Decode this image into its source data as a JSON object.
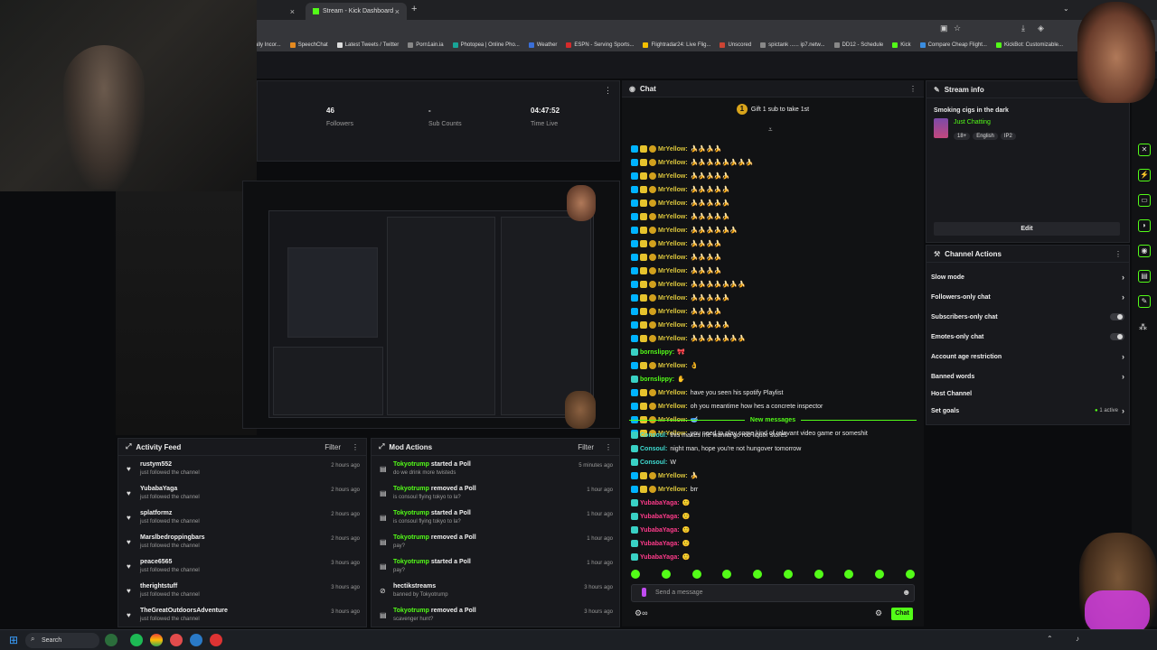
{
  "browser": {
    "tabs": [
      {
        "label": "Stream - Kick Dashboard",
        "active": true
      }
    ],
    "bookmarks": [
      "ally Incor...",
      "SpeechChat",
      "Latest Tweets / Twitter",
      "Porn1ain.ia",
      "Photopea | Online Pho...",
      "Weather",
      "ESPN - Serving Sports...",
      "Flightradar24: Live Flig...",
      "Unscored",
      "spictank ...... ip7.netw...",
      "DD12 - Schedule",
      "Kick",
      "Compare Cheap Flight...",
      "KickBot: Customizable..."
    ]
  },
  "stats": [
    {
      "value": "46",
      "label": "Followers"
    },
    {
      "value": "-",
      "label": "Sub Counts"
    },
    {
      "value": "04:47:52",
      "label": "Time Live"
    }
  ],
  "activity_feed": {
    "title": "Activity Feed",
    "filter_label": "Filter",
    "items": [
      {
        "name": "rustym552",
        "action": "just followed the channel",
        "time": "2 hours ago"
      },
      {
        "name": "YubabaYaga",
        "action": "just followed the channel",
        "time": "2 hours ago"
      },
      {
        "name": "splatformz",
        "action": "just followed the channel",
        "time": "2 hours ago"
      },
      {
        "name": "Marslbedroppingbars",
        "action": "just followed the channel",
        "time": "2 hours ago"
      },
      {
        "name": "peace6565",
        "action": "just followed the channel",
        "time": "3 hours ago"
      },
      {
        "name": "therightstuff",
        "action": "just followed the channel",
        "time": "3 hours ago"
      },
      {
        "name": "TheGreatOutdoorsAdventure",
        "action": "just followed the channel",
        "time": "3 hours ago"
      }
    ]
  },
  "mod_actions": {
    "title": "Mod Actions",
    "filter_label": "Filter",
    "items": [
      {
        "actor": "Tokyotrump",
        "verb": "started a Poll",
        "detail": "do we drink more twisteds",
        "time": "5 minutes ago"
      },
      {
        "actor": "Tokyotrump",
        "verb": "removed a Poll",
        "detail": "is consoul flying tokyo to la?",
        "time": "1 hour ago"
      },
      {
        "actor": "Tokyotrump",
        "verb": "started a Poll",
        "detail": "is consoul flying tokyo to la?",
        "time": "1 hour ago"
      },
      {
        "actor": "Tokyotrump",
        "verb": "removed a Poll",
        "detail": "pay?",
        "time": "1 hour ago"
      },
      {
        "actor": "Tokyotrump",
        "verb": "started a Poll",
        "detail": "pay?",
        "time": "1 hour ago"
      },
      {
        "actor": "hectikstreams",
        "verb": "",
        "detail": "banned by Tokyotrump",
        "time": "3 hours ago"
      },
      {
        "actor": "Tokyotrump",
        "verb": "removed a Poll",
        "detail": "scavenger hunt?",
        "time": "3 hours ago"
      }
    ]
  },
  "chat": {
    "title": "Chat",
    "gift_banner": "Gift 1 sub to take 1st",
    "messages": [
      {
        "user": "MrYellow:",
        "text": "🍌🍌🍌🍌",
        "color": "yellow"
      },
      {
        "user": "MrYellow:",
        "text": "🍌🍌🍌🍌🍌🍌🍌🍌",
        "color": "yellow"
      },
      {
        "user": "MrYellow:",
        "text": "🍌🍌🍌🍌🍌",
        "color": "yellow"
      },
      {
        "user": "MrYellow:",
        "text": "🍌🍌🍌🍌🍌",
        "color": "yellow"
      },
      {
        "user": "MrYellow:",
        "text": "🍌🍌🍌🍌🍌",
        "color": "yellow"
      },
      {
        "user": "MrYellow:",
        "text": "🍌🍌🍌🍌🍌",
        "color": "yellow"
      },
      {
        "user": "MrYellow:",
        "text": "🍌🍌🍌🍌🍌🍌",
        "color": "yellow"
      },
      {
        "user": "MrYellow:",
        "text": "🍌🍌🍌🍌",
        "color": "yellow"
      },
      {
        "user": "MrYellow:",
        "text": "🍌🍌🍌🍌",
        "color": "yellow"
      },
      {
        "user": "MrYellow:",
        "text": "🍌🍌🍌🍌",
        "color": "yellow"
      },
      {
        "user": "MrYellow:",
        "text": "🍌🍌🍌🍌🍌🍌🍌",
        "color": "yellow"
      },
      {
        "user": "MrYellow:",
        "text": "🍌🍌🍌🍌🍌",
        "color": "yellow"
      },
      {
        "user": "MrYellow:",
        "text": "🍌🍌🍌🍌",
        "color": "yellow"
      },
      {
        "user": "MrYellow:",
        "text": "🍌🍌🍌🍌🍌",
        "color": "yellow"
      },
      {
        "user": "MrYellow:",
        "text": "🍌🍌🍌🍌🍌🍌🍌",
        "color": "yellow"
      },
      {
        "user": "bornslippy:",
        "text": "🎀",
        "color": "green"
      },
      {
        "user": "MrYellow:",
        "text": "👌",
        "color": "yellow"
      },
      {
        "user": "bornslippy:",
        "text": "✋",
        "color": "green"
      },
      {
        "user": "MrYellow:",
        "text": "have you seen his spotify Playlist",
        "color": "yellow"
      },
      {
        "user": "MrYellow:",
        "text": "oh you meantime how hes a concrete inspector",
        "color": "yellow"
      },
      {
        "user": "MrYellow:",
        "text": "🥣",
        "color": "yellow"
      },
      {
        "user": "MrYellow:",
        "text": "you need to play some kind of relevant video game or someshit",
        "color": "yellow"
      }
    ],
    "new_messages_label": "New messages",
    "new_messages": [
      {
        "user": "Consoul:",
        "text": "this makes me wanna go rob liquor stores",
        "color": "teal"
      },
      {
        "user": "Consoul:",
        "text": "night man, hope you're not hungover tomorrow",
        "color": "teal"
      },
      {
        "user": "Consoul:",
        "text": "W",
        "color": "teal"
      },
      {
        "user": "MrYellow:",
        "text": "🍌",
        "color": "yellow"
      },
      {
        "user": "MrYellow:",
        "text": "brr",
        "color": "yellow"
      },
      {
        "user": "YubabaYaga:",
        "text": "🙂",
        "color": "pink"
      },
      {
        "user": "YubabaYaga:",
        "text": "🙂",
        "color": "pink"
      },
      {
        "user": "YubabaYaga:",
        "text": "🙂",
        "color": "pink"
      },
      {
        "user": "YubabaYaga:",
        "text": "🙂",
        "color": "pink"
      },
      {
        "user": "YubabaYaga:",
        "text": "🙂",
        "color": "pink"
      }
    ],
    "input_placeholder": "Send a message",
    "send_label": "Chat"
  },
  "stream_info": {
    "title_label": "Stream info",
    "stream_title": "Smoking cigs in the dark",
    "category": "Just Chatting",
    "tags": [
      "18+",
      "English",
      "IP2"
    ],
    "edit_label": "Edit"
  },
  "channel_actions": {
    "title": "Channel Actions",
    "items": [
      {
        "label": "Slow mode",
        "kind": "chevron"
      },
      {
        "label": "Followers-only chat",
        "kind": "chevron"
      },
      {
        "label": "Subscribers-only chat",
        "kind": "toggle"
      },
      {
        "label": "Emotes-only chat",
        "kind": "toggle"
      },
      {
        "label": "Account age restriction",
        "kind": "chevron"
      },
      {
        "label": "Banned words",
        "kind": "chevron"
      },
      {
        "label": "Host Channel",
        "kind": "none"
      },
      {
        "label": "Set goals",
        "kind": "chevron",
        "badge": "1 active"
      }
    ]
  },
  "taskbar": {
    "search_label": "Search"
  },
  "colors": {
    "accent": "#53fc18",
    "panel": "#18191d",
    "background": "#0b0c0e"
  }
}
